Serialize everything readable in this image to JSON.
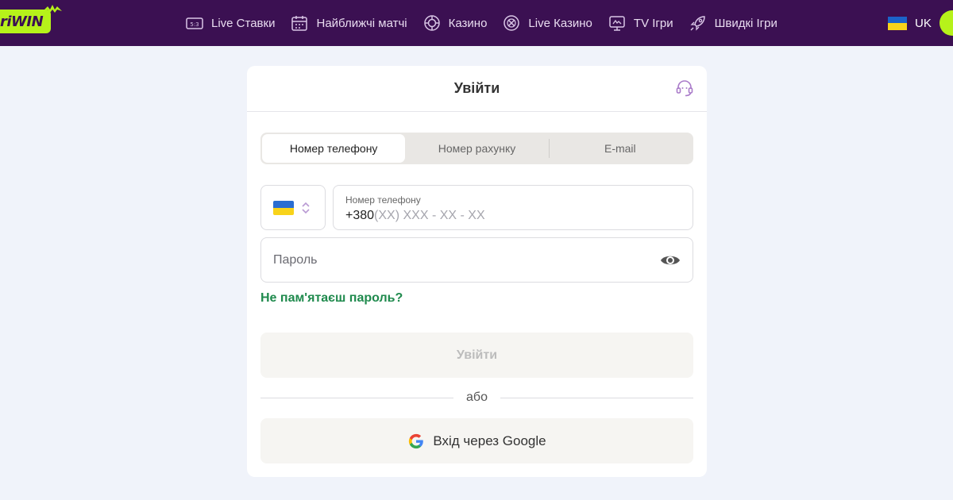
{
  "header": {
    "logo_text": "riWIN",
    "nav": [
      {
        "label": "Live Ставки",
        "icon": "live-score-icon"
      },
      {
        "label": "Найближчі матчі",
        "icon": "calendar-icon"
      },
      {
        "label": "Казино",
        "icon": "casino-chip-icon"
      },
      {
        "label": "Live Казино",
        "icon": "roulette-icon"
      },
      {
        "label": "TV Ігри",
        "icon": "tv-icon"
      },
      {
        "label": "Швидкі Ігри",
        "icon": "rocket-icon"
      }
    ],
    "language": "UK"
  },
  "login": {
    "title": "Увійти",
    "tabs": [
      "Номер телефону",
      "Номер рахунку",
      "E-mail"
    ],
    "phone_label": "Номер телефону",
    "phone_prefix": "+380",
    "phone_mask": "(XX) XXX - XX - XX",
    "password_placeholder": "Пароль",
    "forgot_password": "Не пам'ятаєш пароль?",
    "submit_label": "Увійти",
    "or_label": "або",
    "google_label": "Вхід через Google"
  },
  "colors": {
    "header_bg": "#3b1052",
    "brand_green": "#b6f21a",
    "link_green": "#1f8a4d",
    "page_bg": "#f0f3fa"
  }
}
